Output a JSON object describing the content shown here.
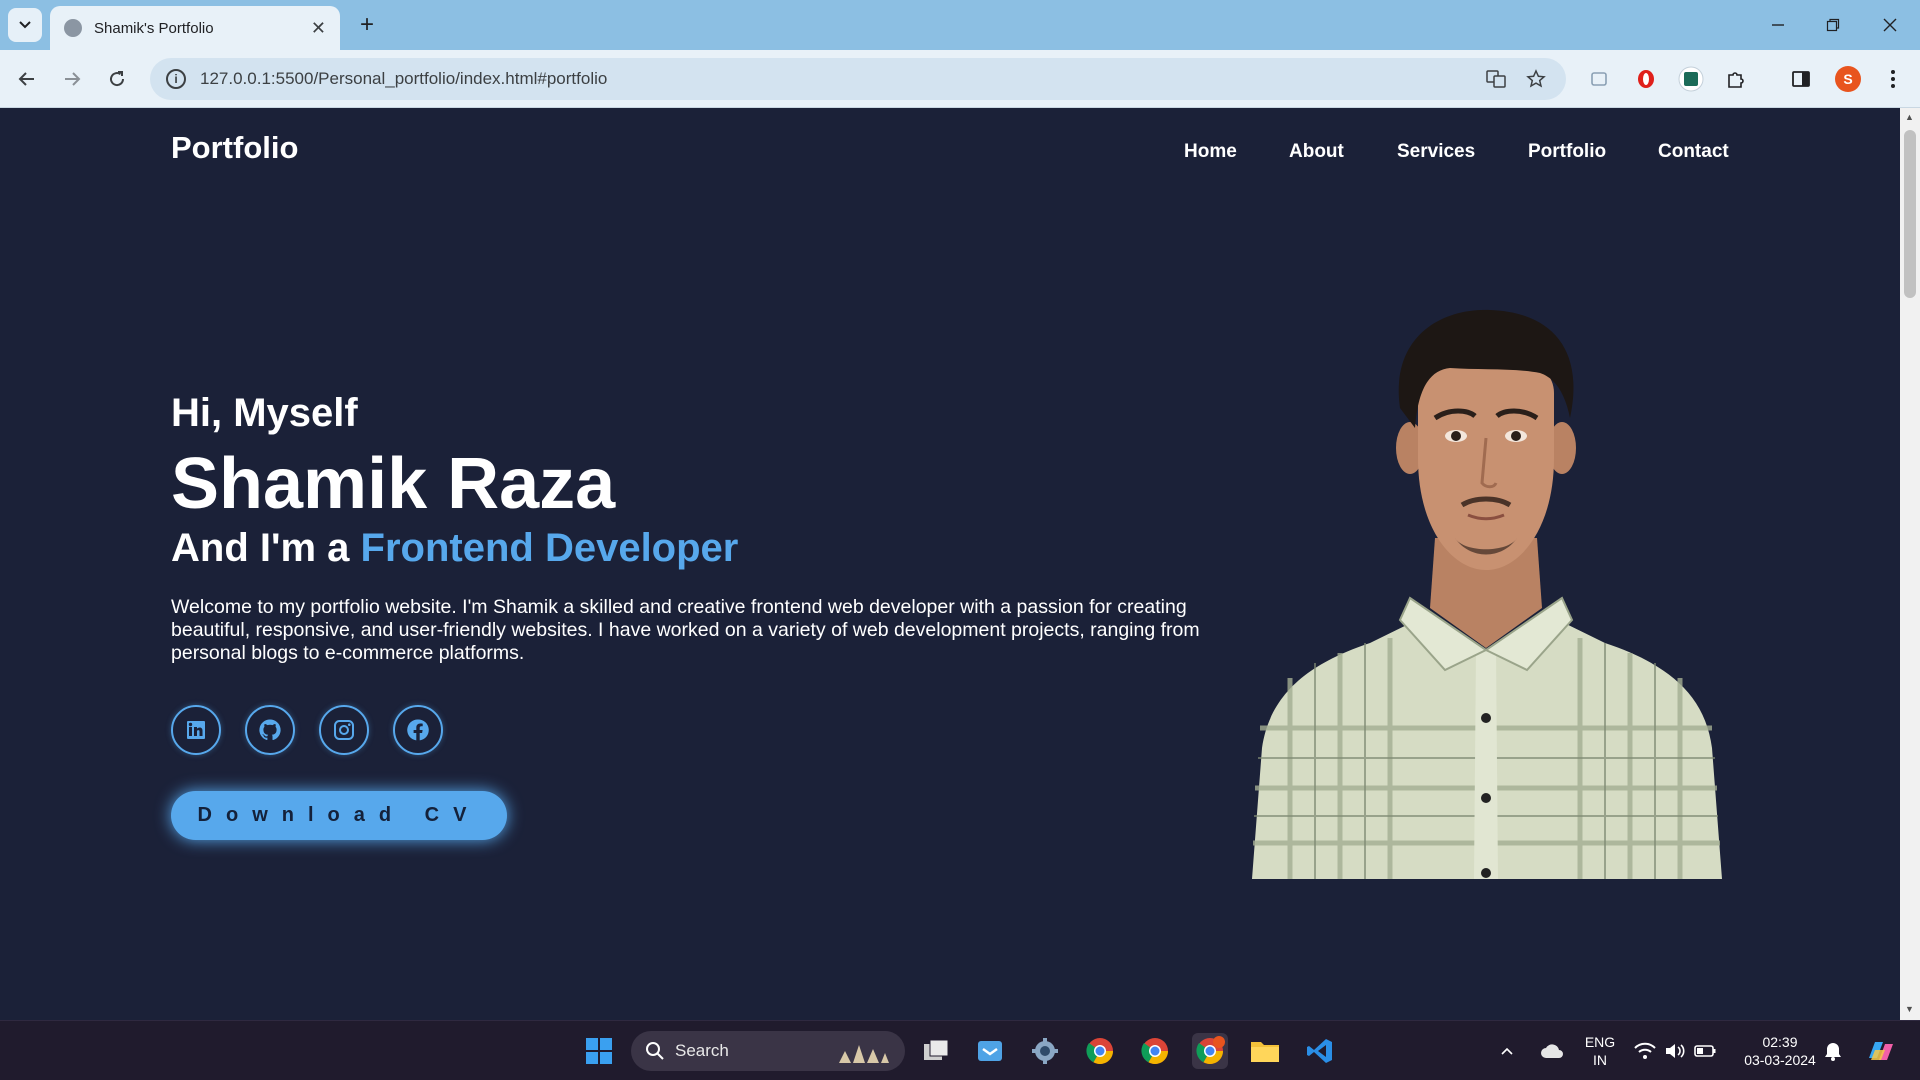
{
  "browser": {
    "tab_title": "Shamik's Portfolio",
    "tab_close": "✕",
    "new_tab": "+",
    "url": "127.0.0.1:5500/Personal_portfolio/index.html#portfolio",
    "profile_initial": "S"
  },
  "site": {
    "logo": "Portfolio",
    "nav": [
      "Home",
      "About",
      "Services",
      "Portfolio",
      "Contact"
    ],
    "hero": {
      "greeting": "Hi, Myself",
      "name": "Shamik Raza",
      "role_prefix": "And I'm a ",
      "role_highlight": "Frontend Developer",
      "intro": "Welcome to my portfolio website. I'm Shamik a skilled and creative frontend web developer with a passion for creating beautiful, responsive, and user-friendly websites. I have worked on a variety of web development projects, ranging from personal blogs to e-commerce platforms.",
      "socials": [
        "linkedin-icon",
        "github-icon",
        "instagram-icon",
        "facebook-icon"
      ],
      "cv_button": "Download CV"
    },
    "colors": {
      "background": "#1b2138",
      "accent": "#57a8ec"
    }
  },
  "taskbar": {
    "search_label": "Search",
    "language_line1": "ENG",
    "language_line2": "IN",
    "time": "02:39",
    "date": "03-03-2024"
  }
}
